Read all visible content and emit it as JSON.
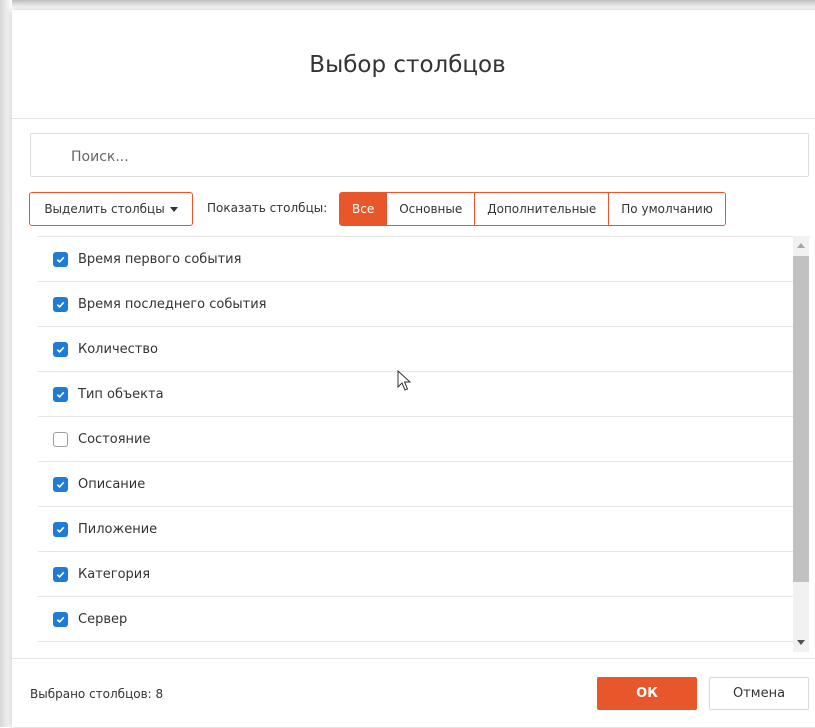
{
  "dialog": {
    "title": "Выбор столбцов"
  },
  "search": {
    "placeholder": "Поиск..."
  },
  "toolbar": {
    "select_columns_label": "Выделить столбцы",
    "show_columns_label": "Показать столбцы:",
    "filters": [
      {
        "label": "Все",
        "active": true
      },
      {
        "label": "Основные",
        "active": false
      },
      {
        "label": "Дополнительные",
        "active": false
      },
      {
        "label": "По умолчанию",
        "active": false
      }
    ]
  },
  "columns": [
    {
      "label": "Время первого события",
      "checked": true
    },
    {
      "label": "Время последнего события",
      "checked": true
    },
    {
      "label": "Количество",
      "checked": true
    },
    {
      "label": "Тип объекта",
      "checked": true
    },
    {
      "label": "Состояние",
      "checked": false
    },
    {
      "label": "Описание",
      "checked": true
    },
    {
      "label": "Пиложение",
      "checked": true
    },
    {
      "label": "Категория",
      "checked": true
    },
    {
      "label": "Сервер",
      "checked": true
    }
  ],
  "footer": {
    "selected_count_text": "Выбрано столбцов: 8",
    "ok_label": "ОК",
    "cancel_label": "Отмена"
  },
  "colors": {
    "accent": "#e8572b",
    "checkbox": "#1e7bd6"
  }
}
